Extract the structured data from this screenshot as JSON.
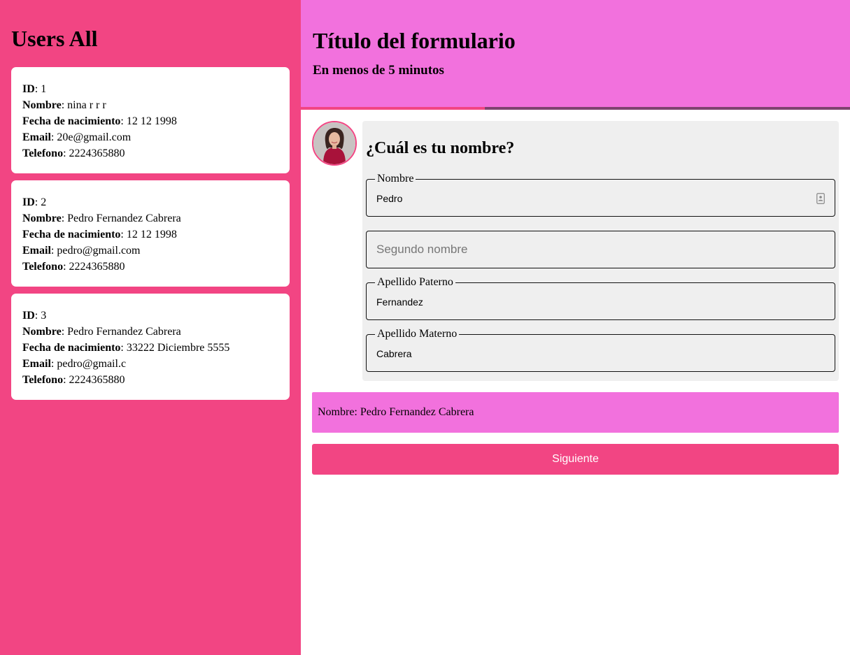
{
  "sidebar": {
    "title": "Users All",
    "field_labels": {
      "id": "ID",
      "nombre": "Nombre",
      "fecha": "Fecha de nacimiento",
      "email": "Email",
      "telefono": "Telefono"
    },
    "users": [
      {
        "id": "1",
        "nombre": "nina r r r",
        "fecha": "12 12 1998",
        "email": "20e@gmail.com",
        "telefono": "2224365880"
      },
      {
        "id": "2",
        "nombre": "Pedro Fernandez Cabrera",
        "fecha": "12 12 1998",
        "email": "pedro@gmail.com",
        "telefono": "2224365880"
      },
      {
        "id": "3",
        "nombre": "Pedro Fernandez Cabrera",
        "fecha": "33222 Diciembre 5555",
        "email": "pedro@gmail.c",
        "telefono": "2224365880"
      }
    ]
  },
  "header": {
    "title": "Título del formulario",
    "subtitle": "En menos de 5 minutos"
  },
  "progress": {
    "fraction": 0.335
  },
  "form": {
    "question": "¿Cuál es tu nombre?",
    "fields": {
      "nombre": {
        "legend": "Nombre",
        "value": "Pedro"
      },
      "segundo": {
        "placeholder": "Segundo nombre"
      },
      "paterno": {
        "legend": "Apellido Paterno",
        "value": "Fernandez"
      },
      "materno": {
        "legend": "Apellido Materno",
        "value": "Cabrera"
      }
    },
    "icon": "contact-card-icon"
  },
  "summary": {
    "text": "Nombre: Pedro Fernandez Cabrera"
  },
  "next_button": {
    "label": "Siguiente"
  },
  "colors": {
    "sidebar_bg": "#f24583",
    "header_bg": "#f271dd",
    "progress_track": "#7f4370",
    "card_bg": "#efefef"
  }
}
